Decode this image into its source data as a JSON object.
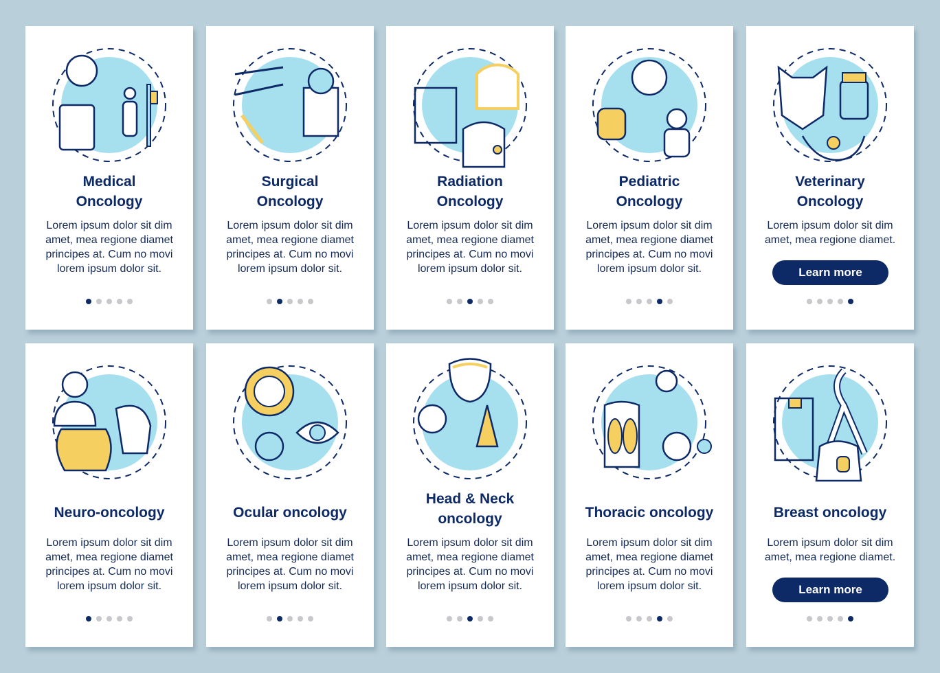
{
  "colors": {
    "background": "#b9cfd9",
    "navy": "#0d2a66",
    "accent_blue": "#a6e0ef",
    "accent_yellow": "#f5cf60",
    "dot_inactive": "#c8c8cc"
  },
  "cards": [
    {
      "title": [
        "Medical",
        "Oncology"
      ],
      "body": [
        "Lorem ipsum dolor sit dim",
        "amet, mea regione diamet",
        "principes at. Cum no movi",
        "lorem ipsum dolor sit."
      ],
      "icon": "medical-oncology-icon",
      "active_dot": 0,
      "dots": 5,
      "button": null
    },
    {
      "title": [
        "Surgical",
        "Oncology"
      ],
      "body": [
        "Lorem ipsum dolor sit dim",
        "amet, mea regione diamet",
        "principes at. Cum no movi",
        "lorem ipsum dolor sit."
      ],
      "icon": "surgical-oncology-icon",
      "active_dot": 1,
      "dots": 5,
      "button": null
    },
    {
      "title": [
        "Radiation",
        "Oncology"
      ],
      "body": [
        "Lorem ipsum dolor sit dim",
        "amet, mea regione diamet",
        "principes at. Cum no movi",
        "lorem ipsum dolor sit."
      ],
      "icon": "radiation-oncology-icon",
      "active_dot": 2,
      "dots": 5,
      "button": null
    },
    {
      "title": [
        "Pediatric",
        "Oncology"
      ],
      "body": [
        "Lorem ipsum dolor sit dim",
        "amet, mea regione diamet",
        "principes at. Cum no movi",
        "lorem ipsum dolor sit."
      ],
      "icon": "pediatric-oncology-icon",
      "active_dot": 3,
      "dots": 5,
      "button": null
    },
    {
      "title": [
        "Veterinary",
        "Oncology"
      ],
      "body": [
        "Lorem ipsum dolor sit dim",
        "amet, mea regione diamet."
      ],
      "icon": "veterinary-oncology-icon",
      "active_dot": 4,
      "dots": 5,
      "button": "Learn more"
    },
    {
      "title": [
        "Neuro-oncology"
      ],
      "body": [
        "Lorem ipsum dolor sit dim",
        "amet, mea regione diamet",
        "principes at. Cum no movi",
        "lorem ipsum dolor sit."
      ],
      "icon": "neuro-oncology-icon",
      "active_dot": 0,
      "dots": 5,
      "button": null
    },
    {
      "title": [
        "Ocular oncology"
      ],
      "body": [
        "Lorem ipsum dolor sit dim",
        "amet, mea regione diamet",
        "principes at. Cum no movi",
        "lorem ipsum dolor sit."
      ],
      "icon": "ocular-oncology-icon",
      "active_dot": 1,
      "dots": 5,
      "button": null
    },
    {
      "title": [
        "Head & Neck",
        "oncology"
      ],
      "body": [
        "Lorem ipsum dolor sit dim",
        "amet, mea regione diamet",
        "principes at. Cum no movi",
        "lorem ipsum dolor sit."
      ],
      "icon": "head-neck-oncology-icon",
      "active_dot": 2,
      "dots": 5,
      "button": null
    },
    {
      "title": [
        "Thoracic oncology"
      ],
      "body": [
        "Lorem ipsum dolor sit dim",
        "amet, mea regione diamet",
        "principes at. Cum no movi",
        "lorem ipsum dolor sit."
      ],
      "icon": "thoracic-oncology-icon",
      "active_dot": 3,
      "dots": 5,
      "button": null
    },
    {
      "title": [
        "Breast oncology"
      ],
      "body": [
        "Lorem ipsum dolor sit dim",
        "amet, mea regione diamet."
      ],
      "icon": "breast-oncology-icon",
      "active_dot": 4,
      "dots": 5,
      "button": "Learn more"
    }
  ]
}
